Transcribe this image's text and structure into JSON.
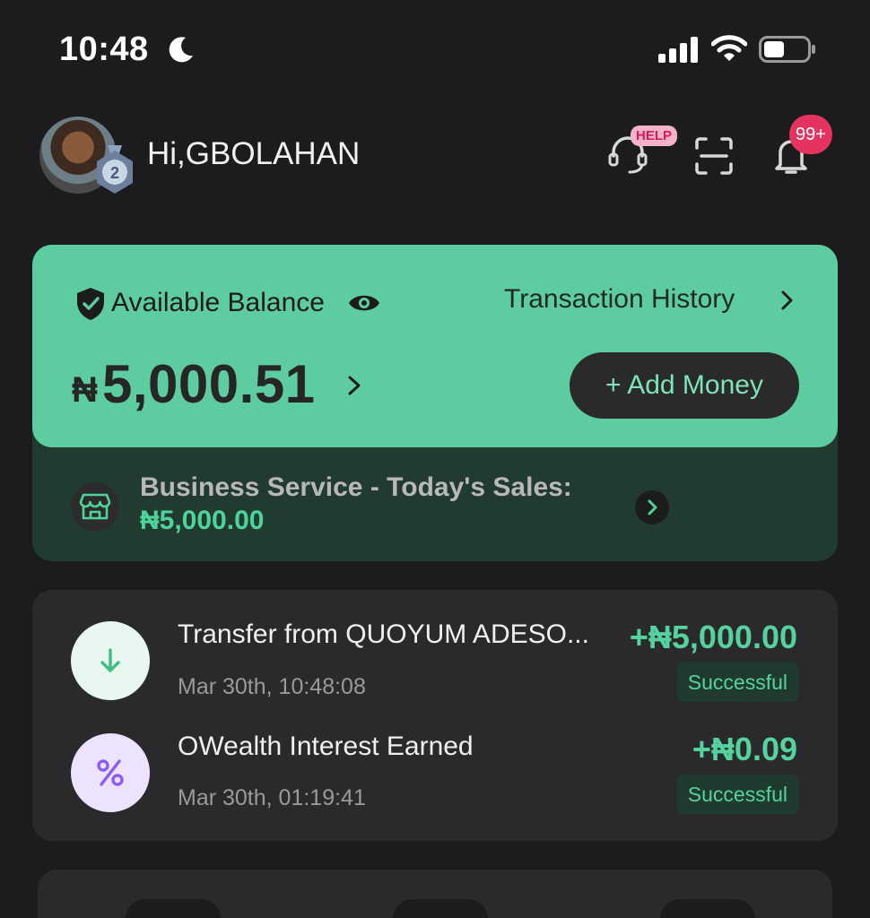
{
  "status_bar": {
    "time": "10:48"
  },
  "header": {
    "greeting": "Hi,GBOLAHAN",
    "medal_level": "2",
    "help_badge": "HELP",
    "notification_badge": "99+"
  },
  "balance_card": {
    "label": "Available Balance",
    "history_link": "Transaction History",
    "currency_symbol": "₦",
    "amount": "5,000.51",
    "add_money": "+ Add Money"
  },
  "business": {
    "title": "Business Service - Today's Sales:",
    "amount": "₦5,000.00"
  },
  "transactions": [
    {
      "title": "Transfer from QUOYUM ADESO...",
      "date": "Mar 30th, 10:48:08",
      "amount": "+₦5,000.00",
      "status": "Successful",
      "icon": "arrow-down-icon"
    },
    {
      "title": "OWealth Interest Earned",
      "date": "Mar 30th, 01:19:41",
      "amount": "+₦0.09",
      "status": "Successful",
      "icon": "percent-icon"
    }
  ],
  "colors": {
    "background": "#1c1c1e",
    "accent_green": "#5ecca1",
    "amount_green": "#55d29f",
    "badge_red": "#e5335f"
  }
}
